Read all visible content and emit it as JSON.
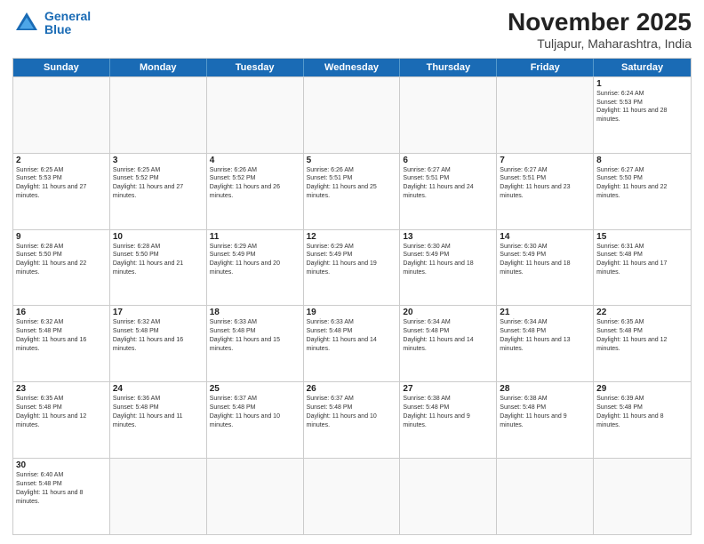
{
  "header": {
    "logo_general": "General",
    "logo_blue": "Blue",
    "month": "November 2025",
    "location": "Tuljapur, Maharashtra, India"
  },
  "days": [
    "Sunday",
    "Monday",
    "Tuesday",
    "Wednesday",
    "Thursday",
    "Friday",
    "Saturday"
  ],
  "rows": [
    [
      {
        "day": "",
        "empty": true
      },
      {
        "day": "",
        "empty": true
      },
      {
        "day": "",
        "empty": true
      },
      {
        "day": "",
        "empty": true
      },
      {
        "day": "",
        "empty": true
      },
      {
        "day": "",
        "empty": true
      },
      {
        "day": "1",
        "sunrise": "Sunrise: 6:24 AM",
        "sunset": "Sunset: 5:53 PM",
        "daylight": "Daylight: 11 hours and 28 minutes."
      }
    ],
    [
      {
        "day": "2",
        "sunrise": "Sunrise: 6:25 AM",
        "sunset": "Sunset: 5:53 PM",
        "daylight": "Daylight: 11 hours and 27 minutes."
      },
      {
        "day": "3",
        "sunrise": "Sunrise: 6:25 AM",
        "sunset": "Sunset: 5:52 PM",
        "daylight": "Daylight: 11 hours and 27 minutes."
      },
      {
        "day": "4",
        "sunrise": "Sunrise: 6:26 AM",
        "sunset": "Sunset: 5:52 PM",
        "daylight": "Daylight: 11 hours and 26 minutes."
      },
      {
        "day": "5",
        "sunrise": "Sunrise: 6:26 AM",
        "sunset": "Sunset: 5:51 PM",
        "daylight": "Daylight: 11 hours and 25 minutes."
      },
      {
        "day": "6",
        "sunrise": "Sunrise: 6:27 AM",
        "sunset": "Sunset: 5:51 PM",
        "daylight": "Daylight: 11 hours and 24 minutes."
      },
      {
        "day": "7",
        "sunrise": "Sunrise: 6:27 AM",
        "sunset": "Sunset: 5:51 PM",
        "daylight": "Daylight: 11 hours and 23 minutes."
      },
      {
        "day": "8",
        "sunrise": "Sunrise: 6:27 AM",
        "sunset": "Sunset: 5:50 PM",
        "daylight": "Daylight: 11 hours and 22 minutes."
      }
    ],
    [
      {
        "day": "9",
        "sunrise": "Sunrise: 6:28 AM",
        "sunset": "Sunset: 5:50 PM",
        "daylight": "Daylight: 11 hours and 22 minutes."
      },
      {
        "day": "10",
        "sunrise": "Sunrise: 6:28 AM",
        "sunset": "Sunset: 5:50 PM",
        "daylight": "Daylight: 11 hours and 21 minutes."
      },
      {
        "day": "11",
        "sunrise": "Sunrise: 6:29 AM",
        "sunset": "Sunset: 5:49 PM",
        "daylight": "Daylight: 11 hours and 20 minutes."
      },
      {
        "day": "12",
        "sunrise": "Sunrise: 6:29 AM",
        "sunset": "Sunset: 5:49 PM",
        "daylight": "Daylight: 11 hours and 19 minutes."
      },
      {
        "day": "13",
        "sunrise": "Sunrise: 6:30 AM",
        "sunset": "Sunset: 5:49 PM",
        "daylight": "Daylight: 11 hours and 18 minutes."
      },
      {
        "day": "14",
        "sunrise": "Sunrise: 6:30 AM",
        "sunset": "Sunset: 5:49 PM",
        "daylight": "Daylight: 11 hours and 18 minutes."
      },
      {
        "day": "15",
        "sunrise": "Sunrise: 6:31 AM",
        "sunset": "Sunset: 5:48 PM",
        "daylight": "Daylight: 11 hours and 17 minutes."
      }
    ],
    [
      {
        "day": "16",
        "sunrise": "Sunrise: 6:32 AM",
        "sunset": "Sunset: 5:48 PM",
        "daylight": "Daylight: 11 hours and 16 minutes."
      },
      {
        "day": "17",
        "sunrise": "Sunrise: 6:32 AM",
        "sunset": "Sunset: 5:48 PM",
        "daylight": "Daylight: 11 hours and 16 minutes."
      },
      {
        "day": "18",
        "sunrise": "Sunrise: 6:33 AM",
        "sunset": "Sunset: 5:48 PM",
        "daylight": "Daylight: 11 hours and 15 minutes."
      },
      {
        "day": "19",
        "sunrise": "Sunrise: 6:33 AM",
        "sunset": "Sunset: 5:48 PM",
        "daylight": "Daylight: 11 hours and 14 minutes."
      },
      {
        "day": "20",
        "sunrise": "Sunrise: 6:34 AM",
        "sunset": "Sunset: 5:48 PM",
        "daylight": "Daylight: 11 hours and 14 minutes."
      },
      {
        "day": "21",
        "sunrise": "Sunrise: 6:34 AM",
        "sunset": "Sunset: 5:48 PM",
        "daylight": "Daylight: 11 hours and 13 minutes."
      },
      {
        "day": "22",
        "sunrise": "Sunrise: 6:35 AM",
        "sunset": "Sunset: 5:48 PM",
        "daylight": "Daylight: 11 hours and 12 minutes."
      }
    ],
    [
      {
        "day": "23",
        "sunrise": "Sunrise: 6:35 AM",
        "sunset": "Sunset: 5:48 PM",
        "daylight": "Daylight: 11 hours and 12 minutes."
      },
      {
        "day": "24",
        "sunrise": "Sunrise: 6:36 AM",
        "sunset": "Sunset: 5:48 PM",
        "daylight": "Daylight: 11 hours and 11 minutes."
      },
      {
        "day": "25",
        "sunrise": "Sunrise: 6:37 AM",
        "sunset": "Sunset: 5:48 PM",
        "daylight": "Daylight: 11 hours and 10 minutes."
      },
      {
        "day": "26",
        "sunrise": "Sunrise: 6:37 AM",
        "sunset": "Sunset: 5:48 PM",
        "daylight": "Daylight: 11 hours and 10 minutes."
      },
      {
        "day": "27",
        "sunrise": "Sunrise: 6:38 AM",
        "sunset": "Sunset: 5:48 PM",
        "daylight": "Daylight: 11 hours and 9 minutes."
      },
      {
        "day": "28",
        "sunrise": "Sunrise: 6:38 AM",
        "sunset": "Sunset: 5:48 PM",
        "daylight": "Daylight: 11 hours and 9 minutes."
      },
      {
        "day": "29",
        "sunrise": "Sunrise: 6:39 AM",
        "sunset": "Sunset: 5:48 PM",
        "daylight": "Daylight: 11 hours and 8 minutes."
      }
    ],
    [
      {
        "day": "30",
        "sunrise": "Sunrise: 6:40 AM",
        "sunset": "Sunset: 5:48 PM",
        "daylight": "Daylight: 11 hours and 8 minutes."
      },
      {
        "day": "",
        "empty": true
      },
      {
        "day": "",
        "empty": true
      },
      {
        "day": "",
        "empty": true
      },
      {
        "day": "",
        "empty": true
      },
      {
        "day": "",
        "empty": true
      },
      {
        "day": "",
        "empty": true
      }
    ]
  ]
}
